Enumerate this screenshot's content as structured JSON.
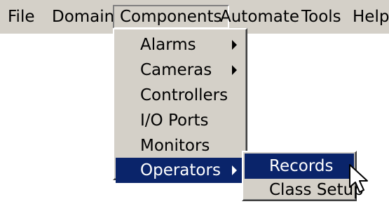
{
  "menubar": {
    "items": [
      {
        "label": "File"
      },
      {
        "label": "Domain"
      },
      {
        "label": "Components"
      },
      {
        "label": "Automate"
      },
      {
        "label": "Tools"
      },
      {
        "label": "Help"
      }
    ]
  },
  "components_menu": {
    "items": [
      {
        "label": "Alarms",
        "submenu": true
      },
      {
        "label": "Cameras",
        "submenu": true
      },
      {
        "label": "Controllers",
        "submenu": false
      },
      {
        "label": "I/O Ports",
        "submenu": false
      },
      {
        "label": "Monitors",
        "submenu": false
      },
      {
        "label": "Operators",
        "submenu": true,
        "highlighted": true
      }
    ]
  },
  "operators_submenu": {
    "items": [
      {
        "label": "Records",
        "highlighted": true
      },
      {
        "label": "Class Setup"
      }
    ]
  },
  "colors": {
    "menu_background": "#d4d0c8",
    "highlight": "#0a246a",
    "highlight_text": "#ffffff"
  },
  "icons": {
    "submenu_arrow": "chevron-right-icon",
    "pointer": "mouse-pointer-icon"
  }
}
